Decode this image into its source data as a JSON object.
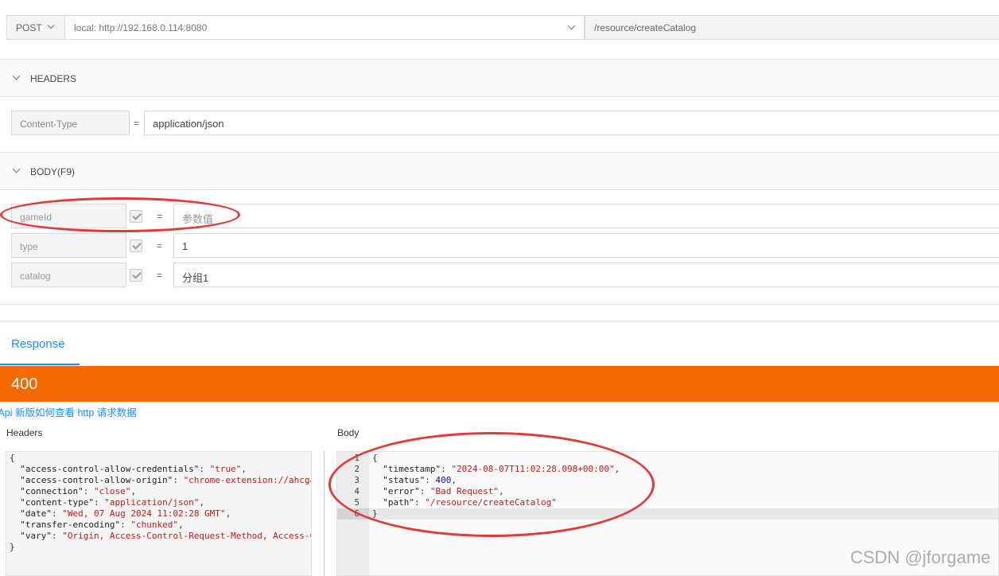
{
  "request": {
    "method": "POST",
    "host": "local: http://192.168.0.114:8080",
    "path": "/resource/createCatalog"
  },
  "headers_section": {
    "title": "HEADERS",
    "rows": [
      {
        "key": "Content-Type",
        "eq": "=",
        "value": "application/json"
      }
    ]
  },
  "body_section": {
    "title": "BODY(F9)",
    "rows": [
      {
        "key": "gameId",
        "eq": "=",
        "value": "参数值",
        "checked": true
      },
      {
        "key": "type",
        "eq": "=",
        "value": "1",
        "checked": true
      },
      {
        "key": "catalog",
        "eq": "=",
        "value": "分组1",
        "checked": true
      }
    ]
  },
  "response": {
    "tab": "Response",
    "status_code": "400",
    "status_color": "#f56a00",
    "link_text": "/Api 新版如何查看 http 请求数据",
    "headers_label": "Headers",
    "body_label": "Body"
  },
  "response_headers_code": [
    "{",
    "  \"access-control-allow-credentials\": \"true\",",
    "  \"access-control-allow-origin\": \"chrome-extension://ahcga",
    "  \"connection\": \"close\",",
    "  \"content-type\": \"application/json\",",
    "  \"date\": \"Wed, 07 Aug 2024 11:02:28 GMT\",",
    "  \"transfer-encoding\": \"chunked\",",
    "  \"vary\": \"Origin, Access-Control-Request-Method, Access-C",
    "}"
  ],
  "response_body_code": [
    {
      "n": "1",
      "text": "{"
    },
    {
      "n": "2",
      "text": "  \"timestamp\": \"2024-08-07T11:02:28.098+00:00\","
    },
    {
      "n": "3",
      "text": "  \"status\": 400,"
    },
    {
      "n": "4",
      "text": "  \"error\": \"Bad Request\","
    },
    {
      "n": "5",
      "text": "  \"path\": \"/resource/createCatalog\""
    },
    {
      "n": "6",
      "text": "}"
    }
  ],
  "watermark": "CSDN @jforgame",
  "colors": {
    "accent": "#1890ff",
    "status": "#f56a00",
    "annotation": "#e23a3a"
  }
}
